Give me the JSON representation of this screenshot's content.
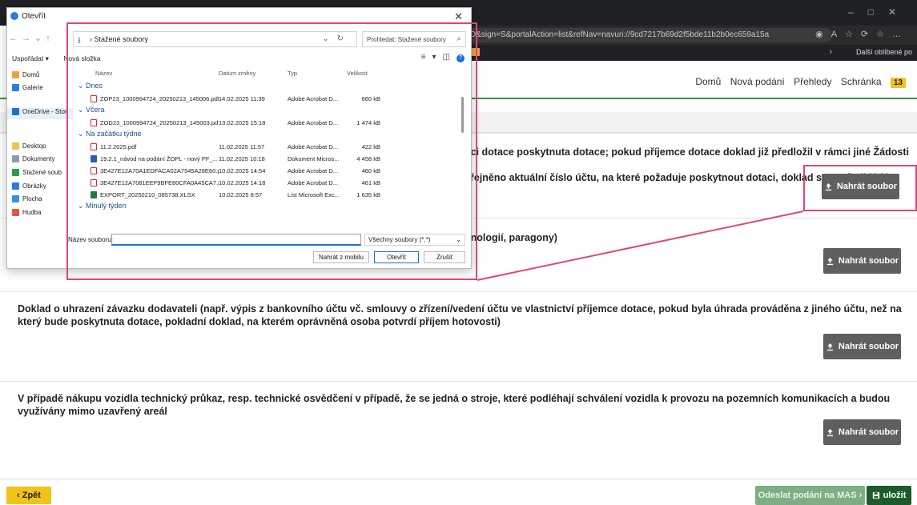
{
  "browser": {
    "url": "D&sign=S&portalAction=list&refNav=navuri://9cd7217b69d2f5bde11b2b0ec659a15a",
    "favorites_label": "Další oblíbené po"
  },
  "nav": {
    "items": [
      "Domů",
      "Nová podání",
      "Přehledy",
      "Schránka"
    ],
    "badge": "13"
  },
  "sections": [
    {
      "text": "nci dotace poskytnuta dotace; pokud příjemce dotace doklad již předložil v rámci jiné Žádosti o",
      "text2": "eřejněno aktuální číslo účtu, na které požaduje poskytnout dotaci, doklad se nepředkládá"
    },
    {
      "text": "hnologií, paragony)"
    },
    {
      "text": "Doklad o uhrazení závazku dodavateli (např. výpis z bankovního účtu vč. smlouvy o zřízení/vedení účtu ve vlastnictví příjemce dotace, pokud byla úhrada prováděna z jiného účtu, než na který bude poskytnuta dotace, pokladní doklad, na kterém oprávněná osoba potvrdí příjem hotovosti)"
    },
    {
      "text": "V případě nákupu vozidla technický průkaz, resp. technické osvědčení v případě, že se jedná o stroje, které podléhají schválení vozidla k provozu na pozemních komunikacích a budou využívány mimo uzavřený areál"
    }
  ],
  "upload_label": "Nahrát soubor",
  "footer": {
    "back": "‹ Zpět",
    "send": "Odeslat podání na MAS ›",
    "save": "uložit"
  },
  "dialog": {
    "title": "Otevřít",
    "path": "Stažené soubory",
    "search_placeholder": "Prohledat: Stažené soubory",
    "organize": "Uspořádat ▾",
    "new_folder": "Nová složka",
    "sidebar": [
      {
        "label": "Domů",
        "icon": "home-icon",
        "color": "#e8a33d"
      },
      {
        "label": "Galerie",
        "icon": "gallery-icon",
        "color": "#2a7de1"
      },
      {
        "label": "OneDrive - Stor",
        "icon": "cloud-icon",
        "color": "#1c6fd6"
      },
      {
        "label": "Desktop",
        "icon": "desktop-icon",
        "color": "#f2c14e"
      },
      {
        "label": "Dokumenty",
        "icon": "documents-icon",
        "color": "#8a9bb0"
      },
      {
        "label": "Stažené soub",
        "icon": "download-icon",
        "color": "#2a9d4a"
      },
      {
        "label": "Obrázky",
        "icon": "pictures-icon",
        "color": "#2a7de1"
      },
      {
        "label": "Plocha",
        "icon": "folder-icon",
        "color": "#3a8fd8"
      },
      {
        "label": "Hudba",
        "icon": "music-icon",
        "color": "#e0593a"
      }
    ],
    "columns": [
      "Název",
      "Datum změny",
      "Typ",
      "Velikost"
    ],
    "groups": [
      {
        "label": "Dnes",
        "files": [
          {
            "name": "ZOP23_1000994724_20250213_145006.pdf",
            "date": "14.02.2025 11:39",
            "type": "Adobe Acrobat D...",
            "size": "660 kB",
            "kind": "pdf"
          }
        ]
      },
      {
        "label": "Včera",
        "files": [
          {
            "name": "ZOD23_1000994724_20250213_145003.pdf",
            "date": "13.02.2025 15:18",
            "type": "Adobe Acrobat D...",
            "size": "1 474 kB",
            "kind": "pdf"
          }
        ]
      },
      {
        "label": "Na začátku týdne",
        "files": [
          {
            "name": "11.2.2025.pdf",
            "date": "11.02.2025 11:57",
            "type": "Adobe Acrobat D...",
            "size": "422 kB",
            "kind": "pdf"
          },
          {
            "name": "19.2.1_návod na podání ŽOPL - nový PF_...",
            "date": "11.02.2025 10:18",
            "type": "Dokument Micros...",
            "size": "4 458 kB",
            "kind": "docx"
          },
          {
            "name": "3E427E12A70A1EDFACA02A7545A28E60.p...",
            "date": "10.02.2025 14:54",
            "type": "Adobe Acrobat D...",
            "size": "460 kB",
            "kind": "pdf"
          },
          {
            "name": "3E427E12A7081EEF9BFE80CFA0A45CA7.pdf",
            "date": "10.02.2025 14:18",
            "type": "Adobe Acrobat D...",
            "size": "461 kB",
            "kind": "pdf"
          },
          {
            "name": "EXPORT_20250210_085738.XLSX",
            "date": "10.02.2025 8:57",
            "type": "List Microsoft Exc...",
            "size": "1 635 kB",
            "kind": "xlsx"
          }
        ]
      },
      {
        "label": "Minulý týden",
        "files": []
      }
    ],
    "filename_label": "Název souboru:",
    "filename_value": "",
    "filetype": "Všechny soubory (*.*)",
    "btn_mobile": "Nahrát z mobilu",
    "btn_open": "Otevřít",
    "btn_cancel": "Zrušit"
  }
}
